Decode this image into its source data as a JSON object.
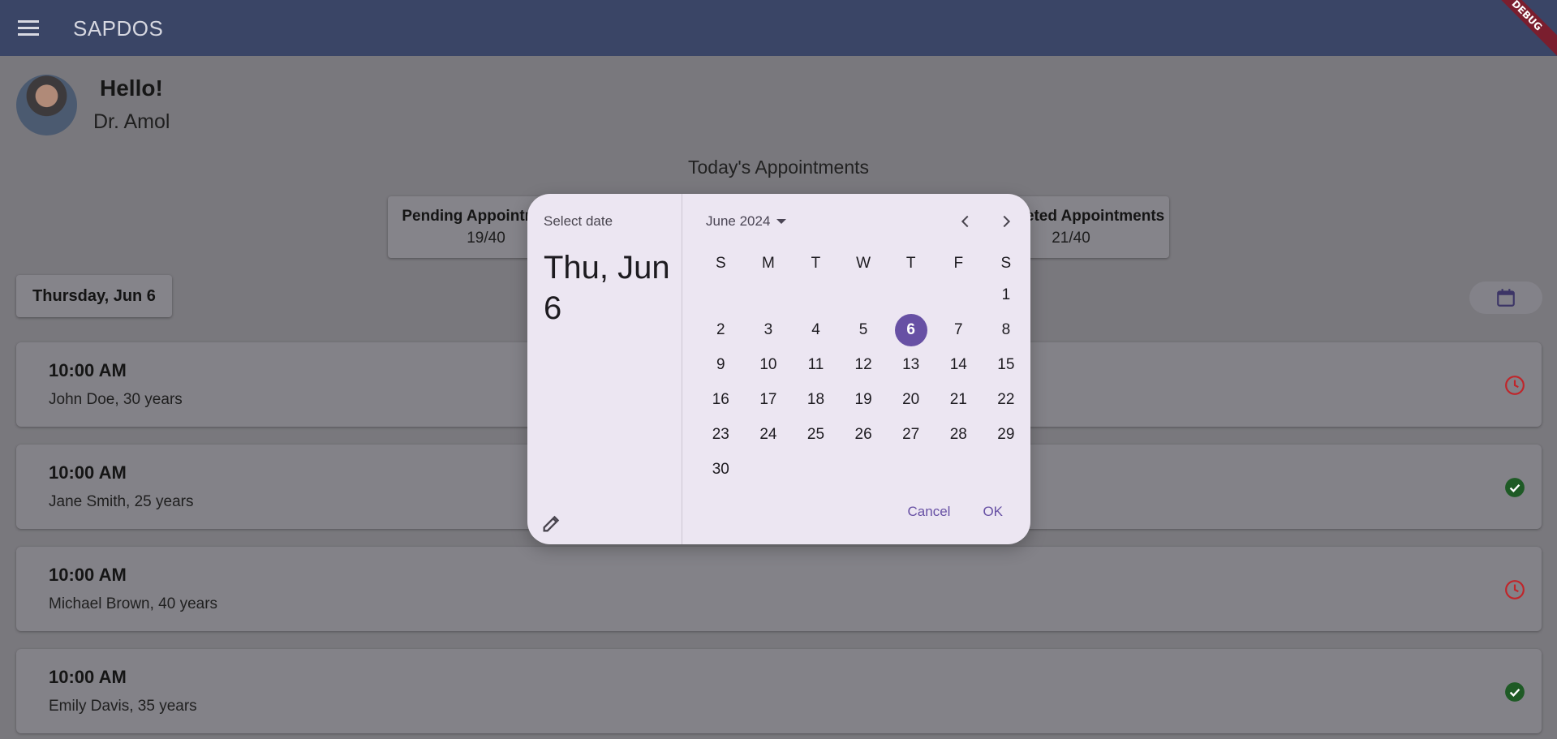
{
  "app": {
    "title": "SAPDOS",
    "debug_banner": "DEBUG"
  },
  "profile": {
    "greeting": "Hello!",
    "name": "Dr. Amol"
  },
  "dashboard": {
    "section_title": "Today's Appointments",
    "pending": {
      "label": "Pending Appointments",
      "value": "19/40"
    },
    "completed": {
      "label": "Completed Appointments",
      "value": "21/40"
    },
    "selected_date_chip": "Thursday, Jun 6"
  },
  "appointments": [
    {
      "time": "10:00 AM",
      "patient": "John Doe, 30 years",
      "status": "pending",
      "icon": "clock-icon",
      "color": "#c0252a"
    },
    {
      "time": "10:00 AM",
      "patient": "Jane Smith, 25 years",
      "status": "done",
      "icon": "check-circle-icon",
      "color": "#1e5a25"
    },
    {
      "time": "10:00 AM",
      "patient": "Michael Brown, 40 years",
      "status": "pending",
      "icon": "clock-icon",
      "color": "#c0252a"
    },
    {
      "time": "10:00 AM",
      "patient": "Emily Davis, 35 years",
      "status": "done",
      "icon": "check-circle-icon",
      "color": "#1e5a25"
    }
  ],
  "date_picker": {
    "helper_text": "Select date",
    "headline": "Thu, Jun 6",
    "month_label": "June 2024",
    "weekdays": [
      "S",
      "M",
      "T",
      "W",
      "T",
      "F",
      "S"
    ],
    "days": [
      "",
      "",
      "",
      "",
      "",
      "",
      "1",
      "2",
      "3",
      "4",
      "5",
      "6",
      "7",
      "8",
      "9",
      "10",
      "11",
      "12",
      "13",
      "14",
      "15",
      "16",
      "17",
      "18",
      "19",
      "20",
      "21",
      "22",
      "23",
      "24",
      "25",
      "26",
      "27",
      "28",
      "29",
      "30"
    ],
    "selected_day": "6",
    "cancel_label": "Cancel",
    "ok_label": "OK",
    "accent_color": "#6750a4"
  }
}
